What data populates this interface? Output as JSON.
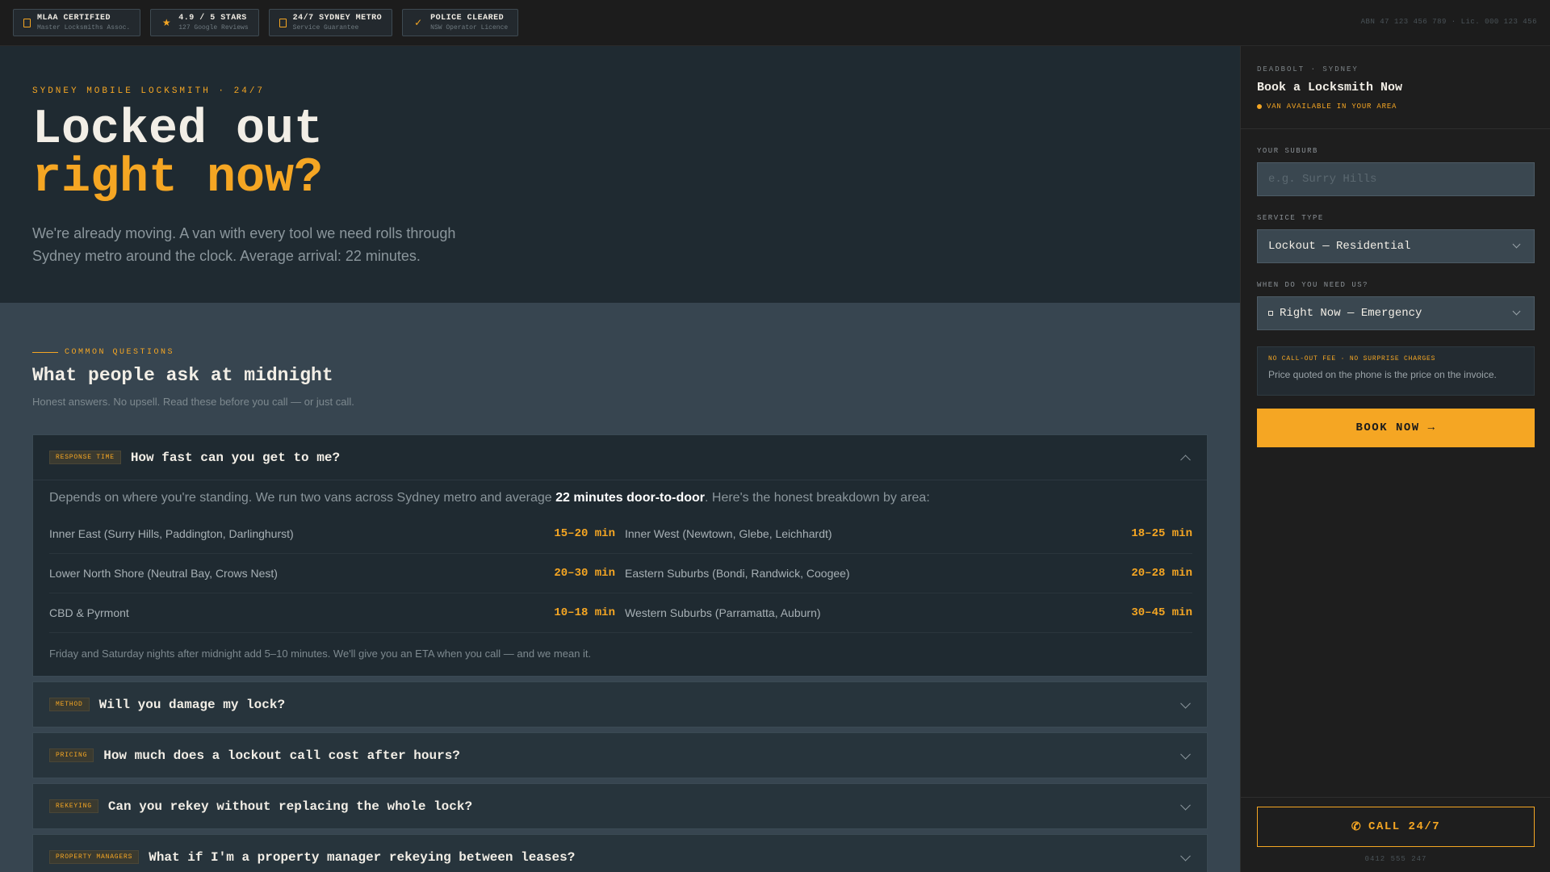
{
  "topbar": {
    "badges": [
      {
        "icon": "shield-icon",
        "title": "MLAA CERTIFIED",
        "sub": "Master Locksmiths Assoc."
      },
      {
        "icon": "star-icon",
        "title": "4.9 / 5 STARS",
        "sub": "127 Google Reviews"
      },
      {
        "icon": "clock-icon",
        "title": "24/7 SYDNEY METRO",
        "sub": "Service Guarantee"
      },
      {
        "icon": "check-icon",
        "title": "POLICE CLEARED",
        "sub": "NSW Operator Licence"
      }
    ],
    "abn": "ABN 47 123 456 789 · Lic. 000 123 456"
  },
  "hero": {
    "eyebrow": "SYDNEY MOBILE LOCKSMITH · 24/7",
    "title_line1": "Locked out",
    "title_line2": "right now?",
    "body": "We're already moving. A van with every tool we need rolls through Sydney metro around the clock. Average arrival: 22 minutes."
  },
  "faq": {
    "eyebrow": "COMMON QUESTIONS",
    "title": "What people ask at midnight",
    "subtitle": "Honest answers. No upsell. Read these before you call — or just call.",
    "items": [
      {
        "tag": "RESPONSE TIME",
        "question": "How fast can you get to me?"
      },
      {
        "tag": "METHOD",
        "question": "Will you damage my lock?"
      },
      {
        "tag": "PRICING",
        "question": "How much does a lockout call cost after hours?"
      },
      {
        "tag": "REKEYING",
        "question": "Can you rekey without replacing the whole lock?"
      },
      {
        "tag": "PROPERTY MANAGERS",
        "question": "What if I'm a property manager rekeying between leases?"
      }
    ],
    "answer": {
      "lead_before": "Depends on where you're standing. We run two vans across Sydney metro and average ",
      "lead_bold": "22 minutes door-to-door",
      "lead_after": ". Here's the honest breakdown by area:",
      "areas": [
        {
          "area": "Inner East (Surry Hills, Paddington, Darlinghurst)",
          "time": "15–20 min"
        },
        {
          "area": "Inner West (Newtown, Glebe, Leichhardt)",
          "time": "18–25 min"
        },
        {
          "area": "Lower North Shore (Neutral Bay, Crows Nest)",
          "time": "20–30 min"
        },
        {
          "area": "Eastern Suburbs (Bondi, Randwick, Coogee)",
          "time": "20–28 min"
        },
        {
          "area": "CBD & Pyrmont",
          "time": "10–18 min"
        },
        {
          "area": "Western Suburbs (Parramatta, Auburn)",
          "time": "30–45 min"
        }
      ],
      "note": "Friday and Saturday nights after midnight add 5–10 minutes. We'll give you an ETA when you call — and we mean it."
    }
  },
  "sidebar": {
    "eyebrow": "DEADBOLT · SYDNEY",
    "title": "Book a Locksmith Now",
    "availability": "VAN AVAILABLE IN YOUR AREA",
    "suburb_label": "YOUR SUBURB",
    "suburb_placeholder": "e.g. Surry Hills",
    "service_label": "SERVICE TYPE",
    "service_value": "Lockout — Residential",
    "when_label": "WHEN DO YOU NEED US?",
    "when_value": "Right Now — Emergency",
    "price_title": "NO CALL-OUT FEE · NO SURPRISE CHARGES",
    "price_desc": "Price quoted on the phone is the price on the invoice.",
    "book_label": "BOOK NOW →",
    "call_label": "CALL 24/7",
    "phone": "0412 555 247"
  },
  "colors": {
    "accent": "#f5a623",
    "hero_bg": "#1f2a31",
    "panel_bg": "#374550",
    "sidebar_bg": "#1e1e1e"
  }
}
